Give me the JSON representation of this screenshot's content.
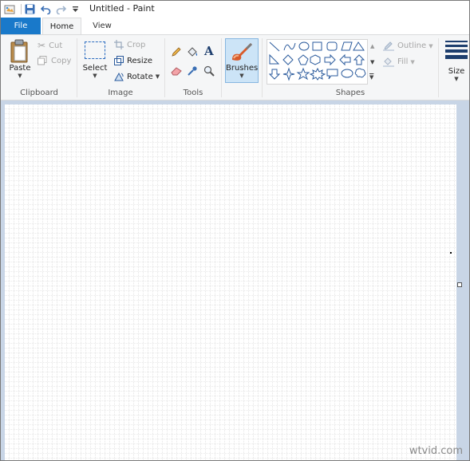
{
  "window": {
    "title": "Untitled - Paint"
  },
  "tabs": [
    {
      "label": "File"
    },
    {
      "label": "Home"
    },
    {
      "label": "View"
    }
  ],
  "ribbon": {
    "clipboard": {
      "label": "Clipboard",
      "paste": "Paste",
      "cut": "Cut",
      "copy": "Copy"
    },
    "image": {
      "label": "Image",
      "select": "Select",
      "crop": "Crop",
      "resize": "Resize",
      "rotate": "Rotate"
    },
    "tools": {
      "label": "Tools"
    },
    "brushes": {
      "label": "Brushes"
    },
    "shapes": {
      "label": "Shapes",
      "outline": "Outline",
      "fill": "Fill"
    },
    "size": {
      "label": "Size"
    }
  },
  "watermark": "wtvid.com",
  "colors": {
    "file_tab": "#1979ca",
    "ribbon_bg": "#f5f6f7",
    "workspace_bg": "#c8d5e6",
    "brushes_active": "#cce4f7"
  }
}
